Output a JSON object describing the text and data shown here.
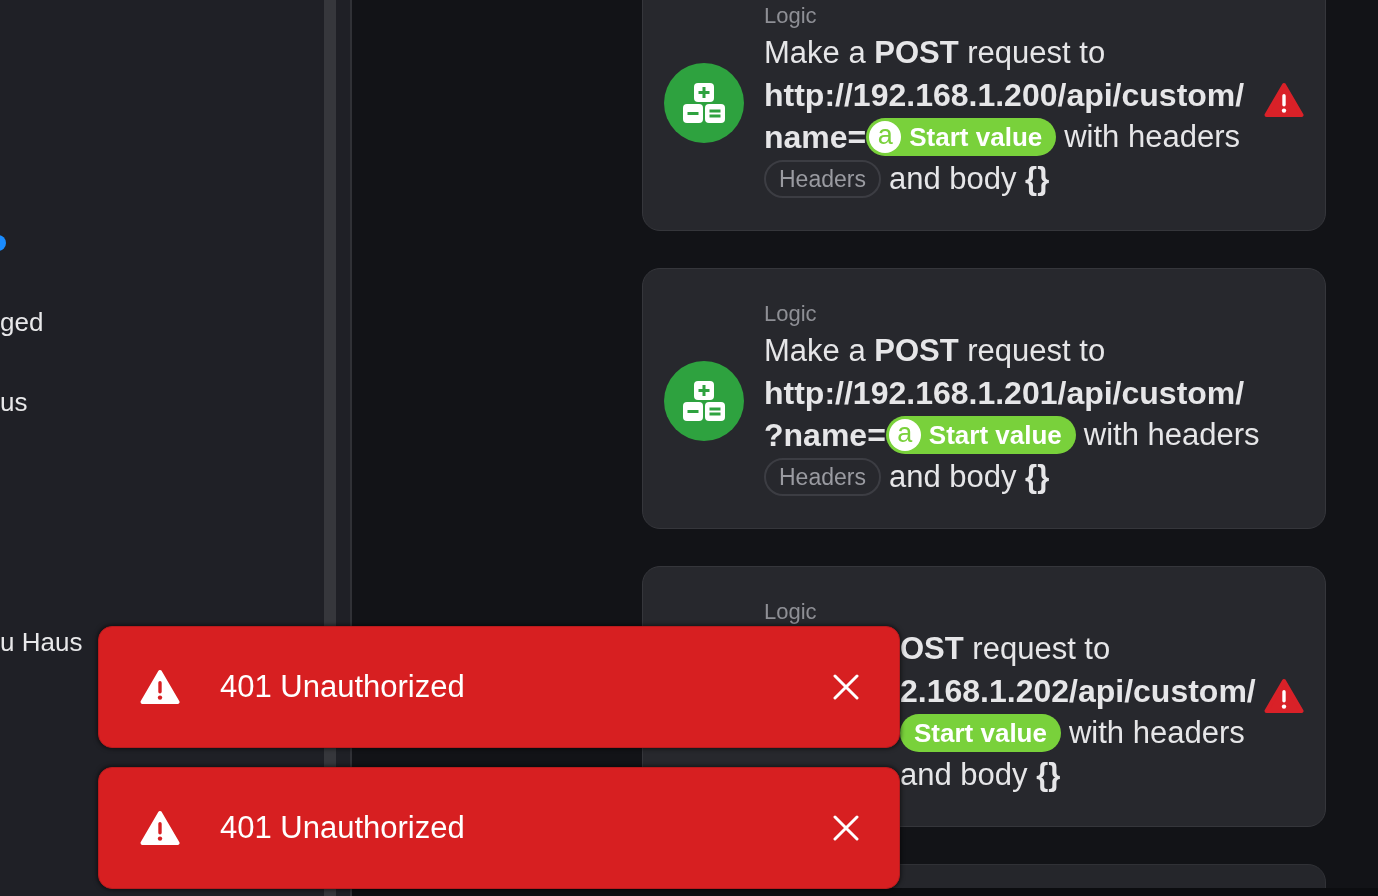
{
  "sidebar": {
    "items": [
      {
        "kind": "dot"
      },
      {
        "kind": "text",
        "text": "ged"
      },
      {
        "kind": "text",
        "text": "us"
      },
      {
        "kind": "text",
        "text": "u Haus"
      }
    ]
  },
  "cards": [
    {
      "category": "Logic",
      "warning": true,
      "lines": [
        [
          {
            "kind": "text",
            "text": "Make a **POST** request to"
          }
        ],
        [
          {
            "kind": "bold",
            "text": "http://192.168.1.200/api/custom/"
          }
        ],
        [
          {
            "kind": "bold",
            "text": "name="
          },
          {
            "kind": "variable",
            "letter": "a",
            "text": "Start value"
          },
          {
            "kind": "text",
            "text": "with headers"
          }
        ],
        [
          {
            "kind": "tag",
            "text": "Headers"
          },
          {
            "kind": "text",
            "text": "and body **{}**"
          }
        ]
      ]
    },
    {
      "category": "Logic",
      "warning": false,
      "lines": [
        [
          {
            "kind": "text",
            "text": "Make a **POST** request to"
          }
        ],
        [
          {
            "kind": "bold",
            "text": "http://192.168.1.201/api/custom/"
          }
        ],
        [
          {
            "kind": "bold",
            "text": "?name="
          },
          {
            "kind": "variable",
            "letter": "a",
            "text": "Start value"
          },
          {
            "kind": "text",
            "text": "with headers"
          }
        ],
        [
          {
            "kind": "tag",
            "text": "Headers"
          },
          {
            "kind": "text",
            "text": "and body **{}**"
          }
        ]
      ]
    },
    {
      "category": "Logic",
      "warning": true,
      "lines": [
        [
          {
            "kind": "text",
            "text": "**OST** request to"
          }
        ],
        [
          {
            "kind": "bold",
            "text": "2.168.1.202/api/custom/"
          }
        ],
        [
          {
            "kind": "variable",
            "text": "Start value"
          },
          {
            "kind": "text",
            "text": "with headers"
          }
        ],
        [
          {
            "kind": "text",
            "text": "and body **{}**"
          }
        ]
      ]
    }
  ],
  "toasts": [
    {
      "kind": "error",
      "message": "401 Unauthorized"
    },
    {
      "kind": "error",
      "message": "401 Unauthorized"
    }
  ]
}
